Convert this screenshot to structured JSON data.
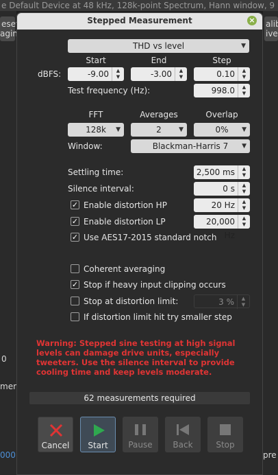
{
  "background": {
    "title_text": "e Default Device at 48 kHz, 128k-point Spectrum, Hann window, 9",
    "left_labels": [
      "eset",
      "agin"
    ],
    "right_labels": [
      "alib",
      "ive"
    ],
    "left_zero": "0",
    "left_ment": "ment",
    "left_blue": "000",
    "right_pre": "pre d"
  },
  "dialog": {
    "title": "Stepped Measurement",
    "close_icon": "close-icon",
    "measurement_type": "THD vs level",
    "sweep": {
      "col_start": "Start",
      "col_end": "End",
      "col_step": "Step",
      "row_label": "dBFS:",
      "start": "-9.00",
      "end": "-3.00",
      "step": "0.10"
    },
    "test_frequency_label": "Test frequency (Hz):",
    "test_frequency": "998.0",
    "fft_header": "FFT",
    "averages_header": "Averages",
    "overlap_header": "Overlap",
    "fft": "128k",
    "averages": "2",
    "overlap": "0%",
    "window_label": "Window:",
    "window": "Blackman-Harris 7",
    "settling_label": "Settling time:",
    "settling": "2,500 ms",
    "silence_label": "Silence interval:",
    "silence": "0 s",
    "hp_label": "Enable distortion HP",
    "hp_checked": true,
    "hp_value": "20 Hz",
    "lp_label": "Enable distortion LP",
    "lp_checked": true,
    "lp_value": "20,000 Hz",
    "aes_label": "Use AES17-2015 standard notch",
    "aes_checked": true,
    "coherent_label": "Coherent averaging",
    "coherent_checked": false,
    "clip_label": "Stop if heavy input clipping occurs",
    "clip_checked": true,
    "limit_label": "Stop at distortion limit:",
    "limit_checked": false,
    "limit_value": "3 %",
    "smaller_label": "If distortion limit hit try smaller step",
    "smaller_checked": false,
    "warning": "Warning: Stepped sine testing at high signal levels can damage drive units, especially tweeters. Use the silence interval to provide cooling time and keep levels moderate.",
    "status": "62 measurements required",
    "buttons": {
      "cancel": "Cancel",
      "start": "Start",
      "pause": "Pause",
      "back": "Back",
      "stop": "Stop"
    },
    "check_mark": "✓",
    "colors": {
      "warning": "#e03434",
      "cancel_icon": "#e03434",
      "start_icon": "#2fa84f",
      "close_button": "#8ab04a"
    }
  }
}
